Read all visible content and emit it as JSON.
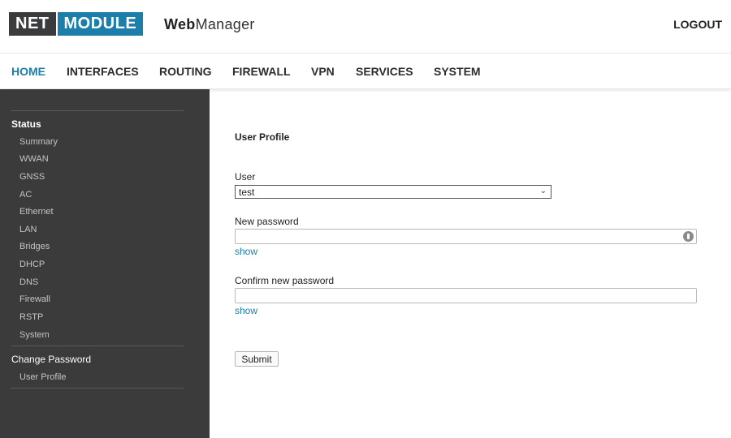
{
  "brand": {
    "net": "NET",
    "module": "MODULE",
    "app_bold": "Web",
    "app_rest": "Manager"
  },
  "header": {
    "logout": "LOGOUT"
  },
  "nav": [
    "HOME",
    "INTERFACES",
    "ROUTING",
    "FIREWALL",
    "VPN",
    "SERVICES",
    "SYSTEM"
  ],
  "sidebar": {
    "status_heading": "Status",
    "status_items": [
      "Summary",
      "WWAN",
      "GNSS",
      "AC",
      "Ethernet",
      "LAN",
      "Bridges",
      "DHCP",
      "DNS",
      "Firewall",
      "RSTP",
      "System"
    ],
    "change_password_heading": "Change Password",
    "change_password_items": [
      "User Profile"
    ]
  },
  "form": {
    "title": "User Profile",
    "user_label": "User",
    "user_value": "test",
    "new_password_label": "New password",
    "new_password_show": "show",
    "confirm_password_label": "Confirm new password",
    "confirm_password_show": "show",
    "submit": "Submit"
  },
  "colors": {
    "accent": "#1d7eaa",
    "sidebar_bg": "#3b3b3b",
    "logo_dark": "#3a3b3c"
  }
}
